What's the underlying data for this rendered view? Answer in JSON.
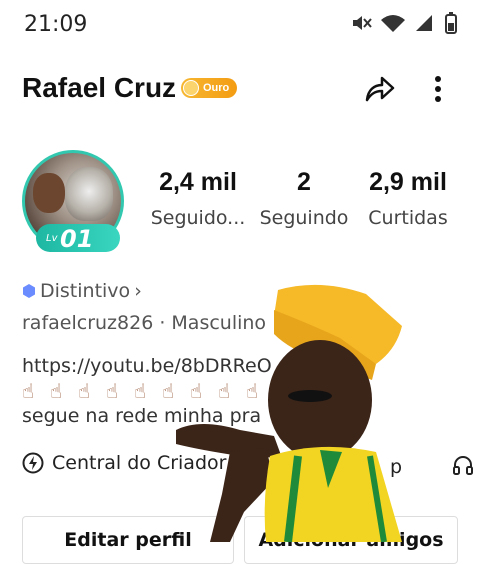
{
  "status_bar": {
    "time": "21:09",
    "icons": [
      "mute-icon",
      "wifi-icon",
      "signal-icon",
      "battery-icon"
    ]
  },
  "profile": {
    "name": "Rafael Cruz",
    "badge_label": "Ouro",
    "level_prefix": "Lv",
    "level_number": "01",
    "stats": [
      {
        "value": "2,4 mil",
        "label": "Seguido..."
      },
      {
        "value": "2",
        "label": "Seguindo"
      },
      {
        "value": "2,9 mil",
        "label": "Curtidas"
      }
    ],
    "distintivo_label": "Distintivo",
    "distintivo_chevron": "›",
    "meta": "rafaelcruz826 · Masculino ·",
    "bio_link": "https://youtu.be/8bDRReO",
    "bio_emoji": [
      "☝",
      "☝",
      "☝",
      "☝",
      "☝",
      "☝",
      "☝",
      "☝",
      "☝"
    ],
    "bio_text": "segue na rede minha pra"
  },
  "tools": {
    "creator_center": "Central do Criador",
    "extra_label": "p"
  },
  "buttons": {
    "edit": "Editar perfil",
    "add_friends": "Adicionar amigos"
  },
  "colors": {
    "accent": "#32c8b0",
    "badge": "#f5a623"
  }
}
